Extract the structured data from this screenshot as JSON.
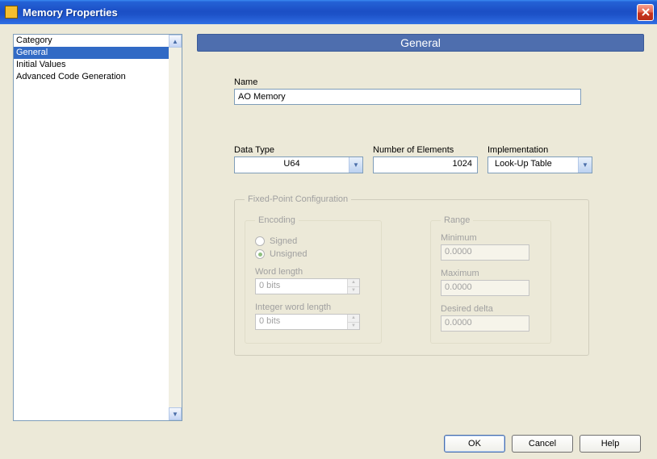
{
  "window": {
    "title": "Memory Properties"
  },
  "category": {
    "header": "Category",
    "items": [
      "General",
      "Initial Values",
      "Advanced Code Generation"
    ],
    "selected_index": 0
  },
  "section": {
    "header": "General"
  },
  "fields": {
    "name_label": "Name",
    "name_value": "AO Memory",
    "datatype_label": "Data Type",
    "datatype_value": "U64",
    "nelem_label": "Number of Elements",
    "nelem_value": "1024",
    "impl_label": "Implementation",
    "impl_value": "Look-Up Table"
  },
  "fixed_point": {
    "legend": "Fixed-Point Configuration",
    "encoding": {
      "legend": "Encoding",
      "signed": "Signed",
      "unsigned": "Unsigned",
      "wordlen_label": "Word length",
      "wordlen_value": "0 bits",
      "intlen_label": "Integer word length",
      "intlen_value": "0 bits"
    },
    "range": {
      "legend": "Range",
      "min_label": "Minimum",
      "min_value": "0.0000",
      "max_label": "Maximum",
      "max_value": "0.0000",
      "delta_label": "Desired delta",
      "delta_value": "0.0000"
    }
  },
  "buttons": {
    "ok": "OK",
    "cancel": "Cancel",
    "help": "Help"
  }
}
